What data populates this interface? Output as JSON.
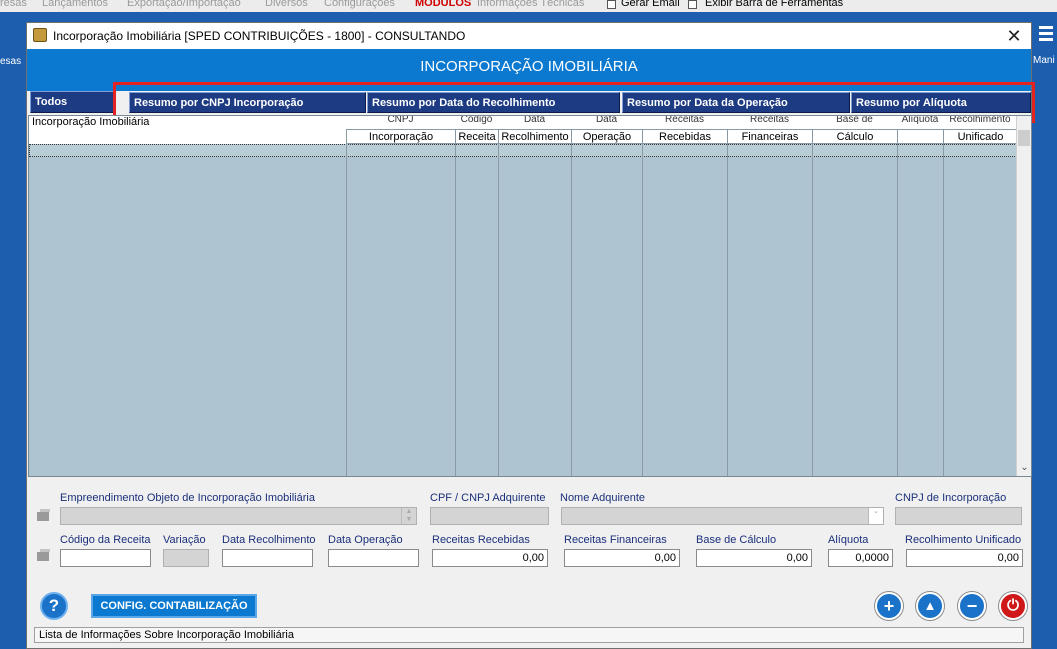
{
  "background": {
    "menu": [
      "resas",
      "Lançamentos",
      "Exportação/Importação",
      "Diversos",
      "Configurações",
      "MÓDULOS",
      "Informações Técnicas"
    ],
    "gerar_email": "Gerar Email",
    "exibir_barra": "Exibir Barra de Ferramentas",
    "left_side_label": "esas",
    "right_side_label": "Mani"
  },
  "window": {
    "title": "Incorporação Imobiliária  [SPED CONTRIBUIÇÕES - 1800]   -   CONSULTANDO",
    "close_glyph": "✕"
  },
  "header": {
    "title": "INCORPORAÇÃO IMOBILIÁRIA"
  },
  "tabs": {
    "todos": "Todos",
    "items": [
      "Resumo por CNPJ Incorporação",
      "Resumo por Data do Recolhimento",
      "Resumo por Data da Operação",
      "Resumo por Alíquota"
    ]
  },
  "grid": {
    "first_col": "Incorporação Imobiliária",
    "columns": [
      {
        "top": "CNPJ",
        "bottom": "Incorporação"
      },
      {
        "top": "Código",
        "bottom": "Receita"
      },
      {
        "top": "Data",
        "bottom": "Recolhimento"
      },
      {
        "top": "Data",
        "bottom": "Operação"
      },
      {
        "top": "Receitas",
        "bottom": "Recebidas"
      },
      {
        "top": "Receitas",
        "bottom": "Financeiras"
      },
      {
        "top": "Base de",
        "bottom": "Cálculo"
      },
      {
        "top": "Alíquota",
        "bottom": ""
      },
      {
        "top": "Recolhimento",
        "bottom": "Unificado"
      }
    ]
  },
  "form": {
    "empreendimento_label": "Empreendimento Objeto de Incorporação Imobiliária",
    "cpf_label": "CPF / CNPJ Adquirente",
    "nome_label": "Nome Adquirente",
    "cnpj_inc_label": "CNPJ de Incorporação",
    "codigo_receita_label": "Código da Receita",
    "variacao_label": "Variação",
    "data_recolhimento_label": "Data Recolhimento",
    "data_operacao_label": "Data Operação",
    "receitas_recebidas_label": "Receitas Recebidas",
    "receitas_recebidas_value": "0,00",
    "receitas_financeiras_label": "Receitas Financeiras",
    "receitas_financeiras_value": "0,00",
    "base_calculo_label": "Base de Cálculo",
    "base_calculo_value": "0,00",
    "aliquota_label": "Alíquota",
    "aliquota_value": "0,0000",
    "recolhimento_unificado_label": "Recolhimento Unificado",
    "recolhimento_unificado_value": "0,00"
  },
  "buttons": {
    "help": "?",
    "config": "CONFIG. CONTABILIZAÇÃO",
    "add": "+",
    "up": "▲",
    "remove": "−",
    "power": "⏻"
  },
  "status": {
    "text": "Lista de Informações Sobre Incorporação Imobiliária"
  },
  "colors": {
    "header": "#0b79d0",
    "tab": "#1c3b82",
    "grid": "#aec4d0",
    "highlight": "#e32222"
  }
}
